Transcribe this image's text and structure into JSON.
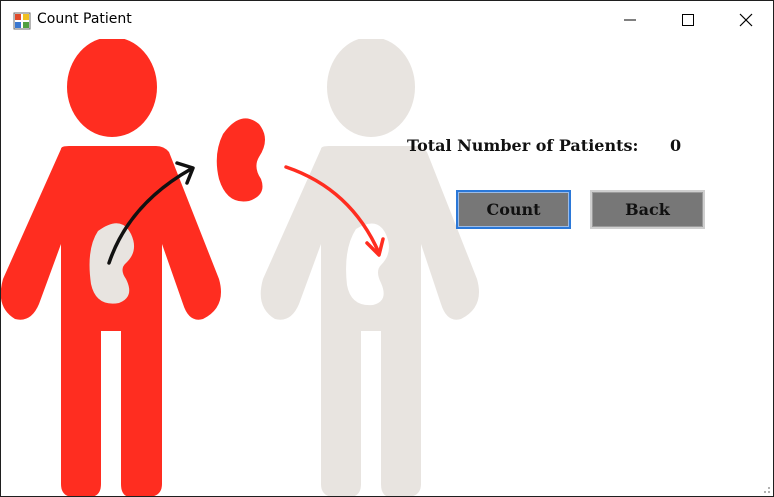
{
  "window": {
    "title": "Count Patient",
    "app_icon": "form-icon",
    "controls": {
      "minimize": "minimize-icon",
      "maximize": "maximize-icon",
      "close": "close-icon"
    }
  },
  "illustration": {
    "description_icon": "kidney-transplant-illustration",
    "colors": {
      "donor": "#ff2d20",
      "recipient": "#e8e4e0",
      "kidney_light": "#e8e4e0",
      "arrow_black": "#111111",
      "arrow_red": "#ff2d20"
    }
  },
  "stats": {
    "total_label": "Total Number of Patients:",
    "total_value": "0"
  },
  "buttons": {
    "count_label": "Count",
    "back_label": "Back"
  },
  "colors": {
    "button_bg": "#777777",
    "focus_border": "#2b78d8"
  }
}
